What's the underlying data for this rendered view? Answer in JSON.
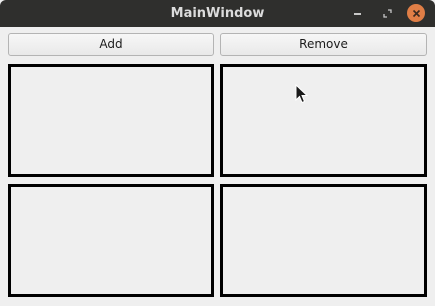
{
  "window": {
    "title": "MainWindow",
    "controls": {
      "minimize": "minimize-icon",
      "maximize": "maximize-icon",
      "close": "close-icon",
      "close_color": "#e07e46"
    }
  },
  "toolbar": {
    "add_label": "Add",
    "remove_label": "Remove"
  },
  "panels": [
    {
      "id": "panel-1"
    },
    {
      "id": "panel-2"
    },
    {
      "id": "panel-3"
    },
    {
      "id": "panel-4"
    }
  ],
  "colors": {
    "titlebar": "#2f2f2d",
    "background": "#efefef",
    "panel_border": "#000000"
  }
}
